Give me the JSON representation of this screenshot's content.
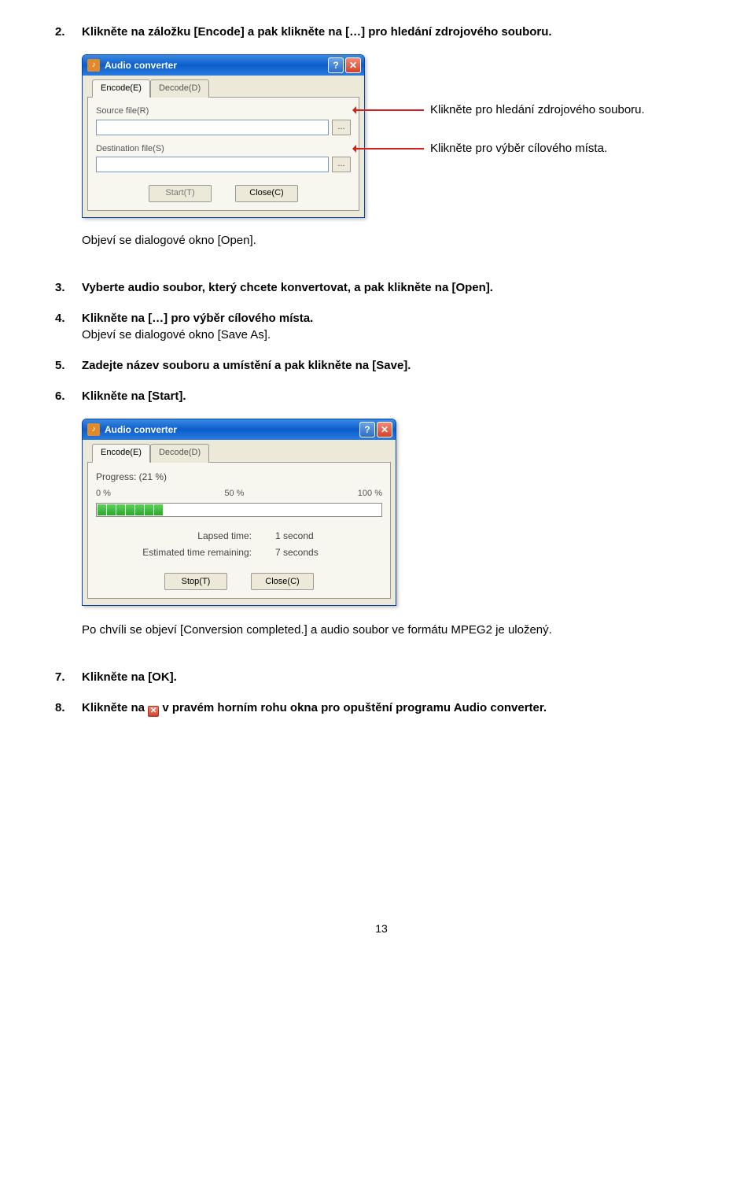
{
  "steps": {
    "s2": {
      "num": "2.",
      "text": "Klikněte na záložku [Encode] a pak klikněte na […] pro hledání zdrojového souboru."
    },
    "s2_note": "Objeví se dialogové okno [Open].",
    "s3": {
      "num": "3.",
      "text": "Vyberte audio soubor, který chcete konvertovat, a pak klikněte na [Open]."
    },
    "s4": {
      "num": "4.",
      "text": "Klikněte na […] pro výběr cílového místa."
    },
    "s4_note": "Objeví se dialogové okno [Save As].",
    "s5": {
      "num": "5.",
      "text": "Zadejte název souboru a umístění a pak klikněte na [Save]."
    },
    "s6": {
      "num": "6.",
      "text": "Klikněte na [Start]."
    },
    "s6_note": "Po chvíli se objeví [Conversion completed.] a audio soubor ve formátu MPEG2 je uložený.",
    "s7": {
      "num": "7.",
      "text": "Klikněte na [OK]."
    },
    "s8": {
      "num": "8.",
      "text_before": "Klikněte na ",
      "text_after": " v pravém horním rohu okna pro opuštění programu Audio converter."
    }
  },
  "callouts": {
    "c1": "Klikněte pro hledání zdrojového souboru.",
    "c2": "Klikněte pro výběr cílového místa."
  },
  "win1": {
    "title": "Audio converter",
    "tab_encode": "Encode(E)",
    "tab_decode": "Decode(D)",
    "source_label": "Source file(R)",
    "dest_label": "Destination file(S)",
    "browse": "...",
    "start_btn": "Start(T)",
    "close_btn": "Close(C)"
  },
  "win2": {
    "title": "Audio converter",
    "tab_encode": "Encode(E)",
    "tab_decode": "Decode(D)",
    "progress": "Progress: (21 %)",
    "p0": "0 %",
    "p50": "50 %",
    "p100": "100 %",
    "lapsed_lbl": "Lapsed time:",
    "lapsed_val": "1 second",
    "remain_lbl": "Estimated time remaining:",
    "remain_val": "7 seconds",
    "stop_btn": "Stop(T)",
    "close_btn": "Close(C)"
  },
  "page_number": "13"
}
